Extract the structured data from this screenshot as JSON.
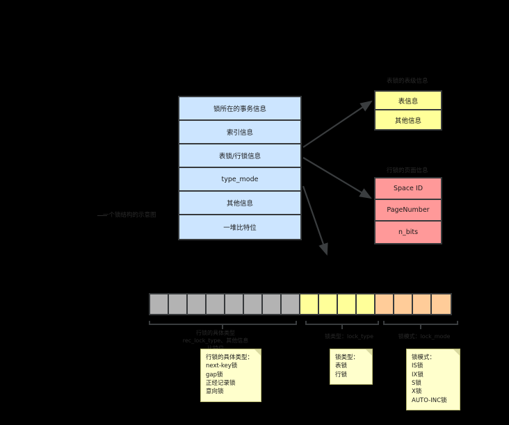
{
  "diagram": {
    "background": "#000000",
    "caption": "一个锁结构的示意图"
  },
  "lock_structure": {
    "name": "锁结构",
    "fill": "#cce5ff",
    "rows": [
      {
        "label": "锁所在的事务信息"
      },
      {
        "label": "索引信息"
      },
      {
        "label": "表锁/行锁信息"
      },
      {
        "label": "type_mode"
      },
      {
        "label": "其他信息"
      },
      {
        "label": "一堆比特位"
      }
    ]
  },
  "table_info": {
    "title": "表锁的表级信息",
    "fill": "#ffff99",
    "rows": [
      {
        "label": "表信息"
      },
      {
        "label": "其他信息"
      }
    ]
  },
  "page_info": {
    "title": "行锁的页面信息",
    "fill": "#ff9999",
    "rows": [
      {
        "label": "Space ID"
      },
      {
        "label": "PageNumber"
      },
      {
        "label": "n_bits"
      }
    ]
  },
  "bit_bar": {
    "groups": [
      {
        "name": "rec-lock-type-group",
        "count": 8,
        "color": "#b3b3b3"
      },
      {
        "name": "lock-type-group",
        "count": 4,
        "color": "#ffff99"
      },
      {
        "name": "lock-mode-group",
        "count": 4,
        "color": "#ffcc99"
      }
    ],
    "brackets": [
      {
        "label_line1": "行锁的具体类型",
        "label_line2": "rec_lock_type、其他信息",
        "label_line3": "比特位"
      },
      {
        "label_line1": "锁类型：lock_type",
        "label_line2": "",
        "label_line3": ""
      },
      {
        "label_line1": "锁模式：lock_mode",
        "label_line2": "",
        "label_line3": ""
      }
    ]
  },
  "notes": [
    {
      "name": "rec-lock-type-note",
      "lines": [
        "行锁的具体类型：",
        "next-key锁",
        "gap锁",
        "正经记录锁",
        "意向锁"
      ]
    },
    {
      "name": "lock-type-note",
      "lines": [
        "锁类型：",
        "表锁",
        "行锁"
      ]
    },
    {
      "name": "lock-mode-note",
      "lines": [
        "锁模式：",
        "IS锁",
        "IX锁",
        "S锁",
        "X锁",
        "AUTO-INC锁"
      ]
    }
  ]
}
